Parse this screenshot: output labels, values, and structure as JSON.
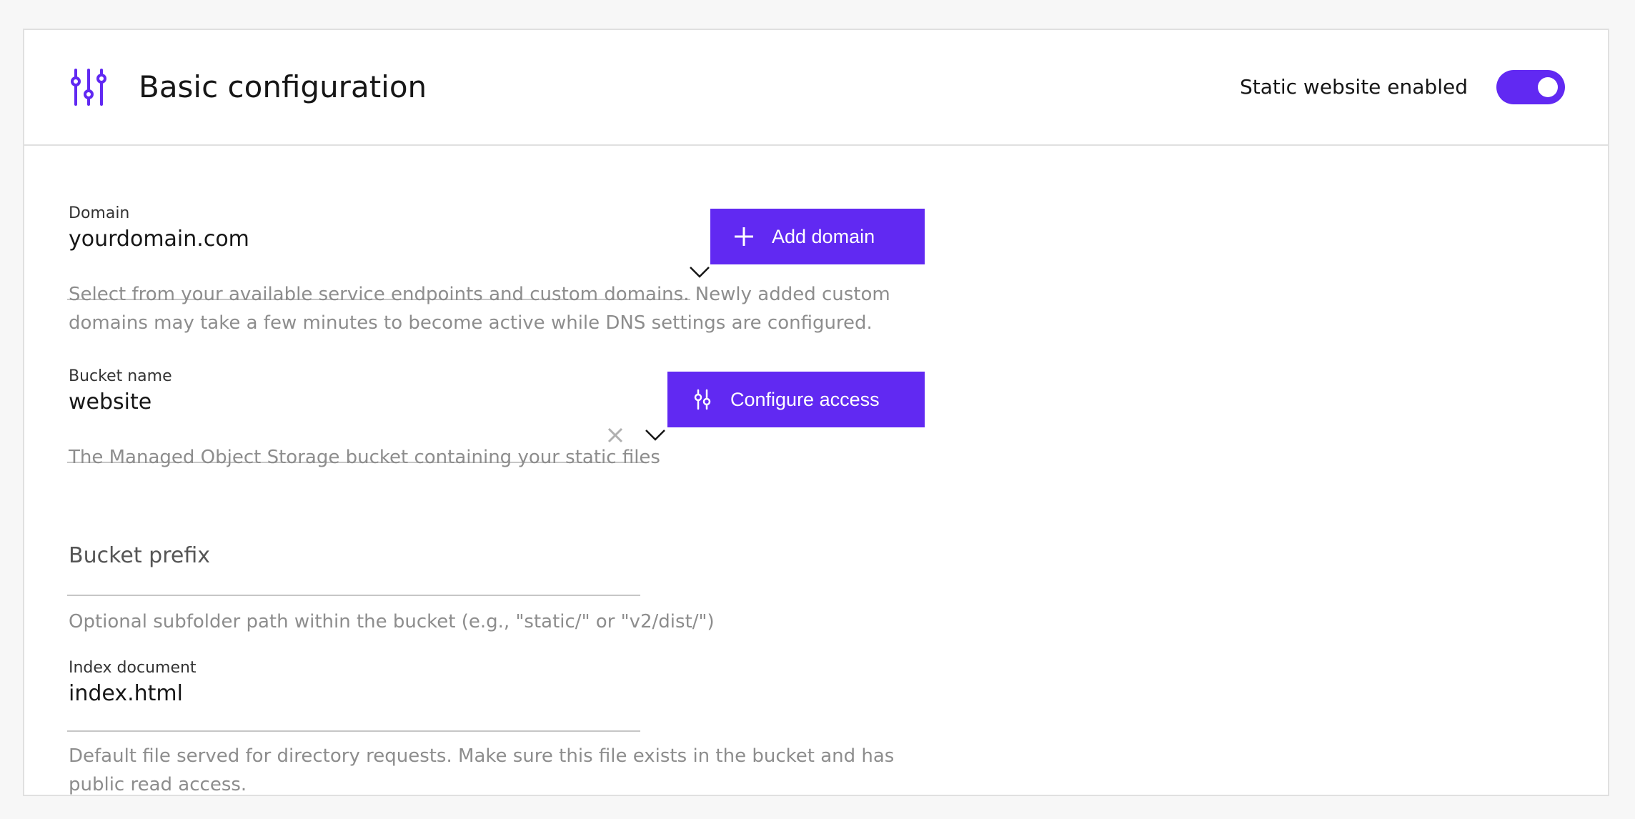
{
  "header": {
    "title": "Basic configuration",
    "icon": "sliders-icon",
    "toggle_label": "Static website enabled",
    "toggle_on": true
  },
  "domain": {
    "label": "Domain",
    "value": "yourdomain.com",
    "help": "Select from your available service endpoints and custom domains. Newly added custom domains may take a few minutes to become active while DNS settings are configured.",
    "button_label": "Add domain",
    "button_icon": "plus-icon"
  },
  "bucket": {
    "label": "Bucket name",
    "value": "website",
    "help": "The Managed Object Storage bucket containing your static files",
    "button_label": "Configure access",
    "button_icon": "sliders-icon"
  },
  "prefix": {
    "placeholder": "Bucket prefix",
    "help": "Optional subfolder path within the bucket (e.g., \"static/\" or \"v2/dist/\")"
  },
  "index": {
    "label": "Index document",
    "value": "index.html",
    "help": "Default file served for directory requests. Make sure this file exists in the bucket and has public read access."
  },
  "colors": {
    "accent": "#6129f2",
    "help_text": "#8d8d8d",
    "divider": "#e0e0e0"
  }
}
